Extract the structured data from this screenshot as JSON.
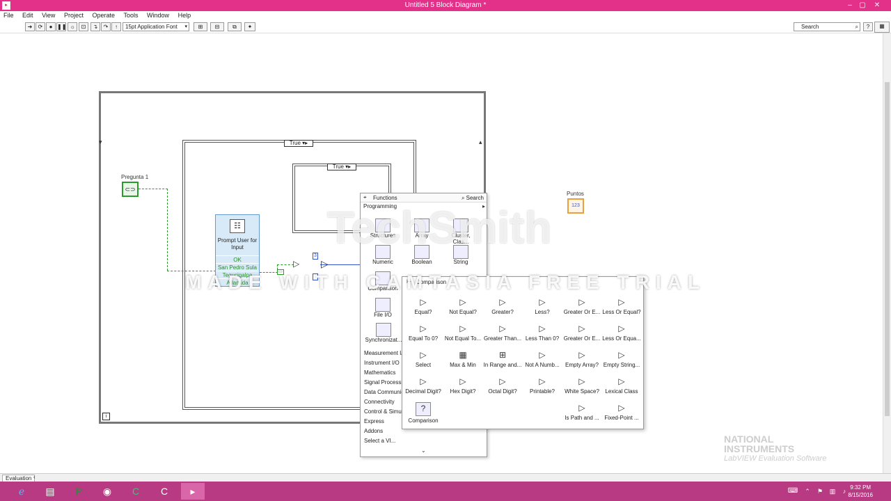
{
  "window": {
    "title": "Untitled 5 Block Diagram *",
    "minimize": "‒",
    "maximize": "▢",
    "close": "✕"
  },
  "menu": [
    "File",
    "Edit",
    "View",
    "Project",
    "Operate",
    "Tools",
    "Window",
    "Help"
  ],
  "toolbar": {
    "font": "15pt Application Font",
    "search_placeholder": "Search"
  },
  "diagram": {
    "case_outer_selector": "True",
    "case_inner_selector": "True",
    "control_label": "Pregunta 1",
    "indicator_label": "Puntos",
    "indicator_value": "123",
    "prompt": {
      "title": "Prompt User for Input",
      "rows": [
        "OK",
        "San Pedro Sula",
        "Tegucigalpa",
        "Atlantida"
      ]
    },
    "constant_value": "3"
  },
  "functions_palette": {
    "title": "Functions",
    "search": "Search",
    "category": "Programming",
    "items": [
      "Structures",
      "Array",
      "Cluster, Clas...",
      "Numeric",
      "Boolean",
      "String",
      "Comparison",
      "File I/O",
      "Synchronizat..."
    ],
    "list": [
      "Measurement I/O",
      "Instrument I/O",
      "Mathematics",
      "Signal Processing",
      "Data Communication",
      "Connectivity",
      "Control & Simulation",
      "Express",
      "Addons",
      "Select a VI..."
    ],
    "more": "⌄"
  },
  "comparison_palette": {
    "title": "Comparison",
    "items": [
      "Equal?",
      "Not Equal?",
      "Greater?",
      "Less?",
      "Greater Or E...",
      "Less Or Equal?",
      "Equal To 0?",
      "Not Equal To...",
      "Greater Than...",
      "Less Than 0?",
      "Greater Or E...",
      "Less Or Equa...",
      "Select",
      "Max & Min",
      "In Range and...",
      "Not A Numb...",
      "Empty Array?",
      "Empty String...",
      "Decimal Digit?",
      "Hex Digit?",
      "Octal Digit?",
      "Printable?",
      "White Space?",
      "Lexical Class",
      "Comparison",
      "Is Path and ...",
      "Fixed-Point ..."
    ]
  },
  "watermark": {
    "brand": "TechSmith",
    "trial": "MADE WITH CAMTASIA FREE TRIAL"
  },
  "ni_logo": {
    "line1": "NATIONAL",
    "line2": "INSTRUMENTS",
    "line3": "LabVIEW Evaluation Software"
  },
  "statusbar": {
    "mode": "Evaluation"
  },
  "taskbar": {
    "time": "9:32 PM",
    "date": "8/15/2016"
  }
}
